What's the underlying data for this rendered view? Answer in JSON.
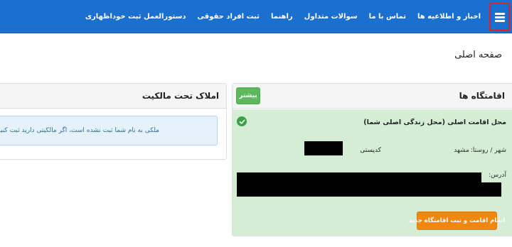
{
  "navbar": {
    "menu_icon": "hamburger-menu-icon",
    "links": [
      "اخبار و اطلاعیه ها",
      "تماس با ما",
      "سوالات متداول",
      "راهنما",
      "ثبت افراد حقوقی",
      "دستورالعمل ثبت خوداظهاری"
    ]
  },
  "page": {
    "title": "صفحه اصلی"
  },
  "residences": {
    "title": "اقامتگاه ها",
    "more_label": "بیشتر",
    "card": {
      "heading": "محل اقامت اصلی (محل زندگی اصلی شما)",
      "city_label": "شهر / روستا:",
      "city_value": "مشهد",
      "postal_label": "کدپستی",
      "address_label": "آدرس:",
      "complete_button": "اتمام اقامت و ثبت اقامتگاه جدید",
      "check_icon": "check-circle-icon"
    }
  },
  "properties": {
    "title": "املاک تحت مالکیت",
    "info_message": "ملکی به نام شما ثبت نشده است، اگر مالکیتی دارید ثبت کنید"
  },
  "colors": {
    "navbar": "#1a6fcf",
    "menu_border": "#d7262b",
    "success_bg": "#d4edd4",
    "more_button": "#5cb85c",
    "complete_button": "#f0870f",
    "info_bg": "#e6f2fb",
    "info_text": "#31708f"
  }
}
